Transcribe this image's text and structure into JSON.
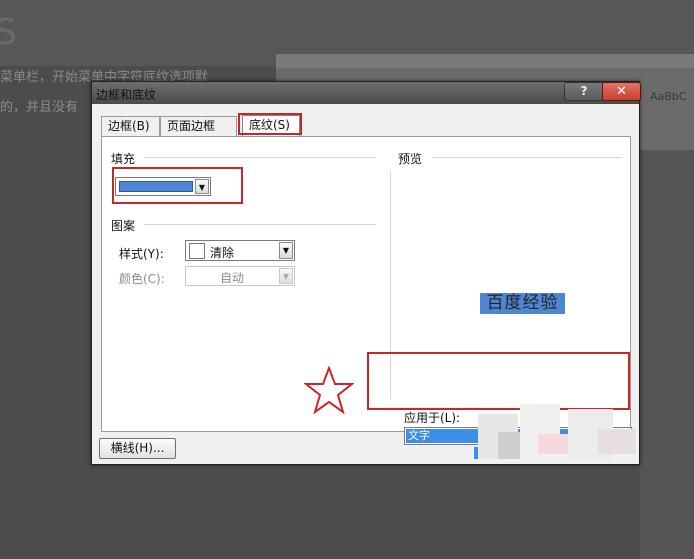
{
  "background": {
    "ghost_letter": "S",
    "line1": "菜单栏，开始菜单中字符底纹选项默",
    "line2": "的，并且没有",
    "ribbon_style_text": "AaBbC"
  },
  "dialog": {
    "title": "边框和底纹",
    "help_label": "?",
    "close_label": "✕",
    "tabs": [
      {
        "label": "边框(B)"
      },
      {
        "label": "页面边框(P)"
      },
      {
        "label": "底纹(S)"
      }
    ],
    "fill": {
      "label": "填充",
      "color": "#4f86d4"
    },
    "pattern": {
      "label": "图案",
      "style_label": "样式(Y):",
      "style_value": "清除",
      "color_label": "颜色(C):",
      "color_value": "自动"
    },
    "preview": {
      "label": "预览",
      "sample_text": "百度经验",
      "highlight_color": "#4f86d4"
    },
    "apply_to": {
      "label": "应用于(L):",
      "value": "文字"
    },
    "horizontal_line_button": "横线(H)..."
  },
  "colors": {
    "annotation_red": "#c62828",
    "selection_blue": "#3d8ee6"
  }
}
